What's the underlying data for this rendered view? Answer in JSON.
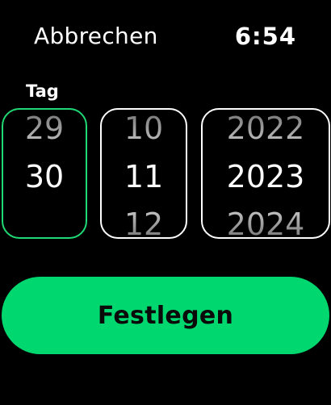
{
  "header": {
    "cancel_label": "Abbrechen",
    "time": "6:54"
  },
  "picker": {
    "active_field_label": "Tag",
    "day": {
      "prev": "29",
      "current": "30",
      "next": ""
    },
    "month": {
      "prev": "10",
      "current": "11",
      "next": "12"
    },
    "year": {
      "prev": "2022",
      "current": "2023",
      "next": "2024"
    }
  },
  "actions": {
    "set_label": "Festlegen"
  },
  "colors": {
    "accent": "#00d86f",
    "active_border": "#1fd975",
    "background": "#000000"
  }
}
